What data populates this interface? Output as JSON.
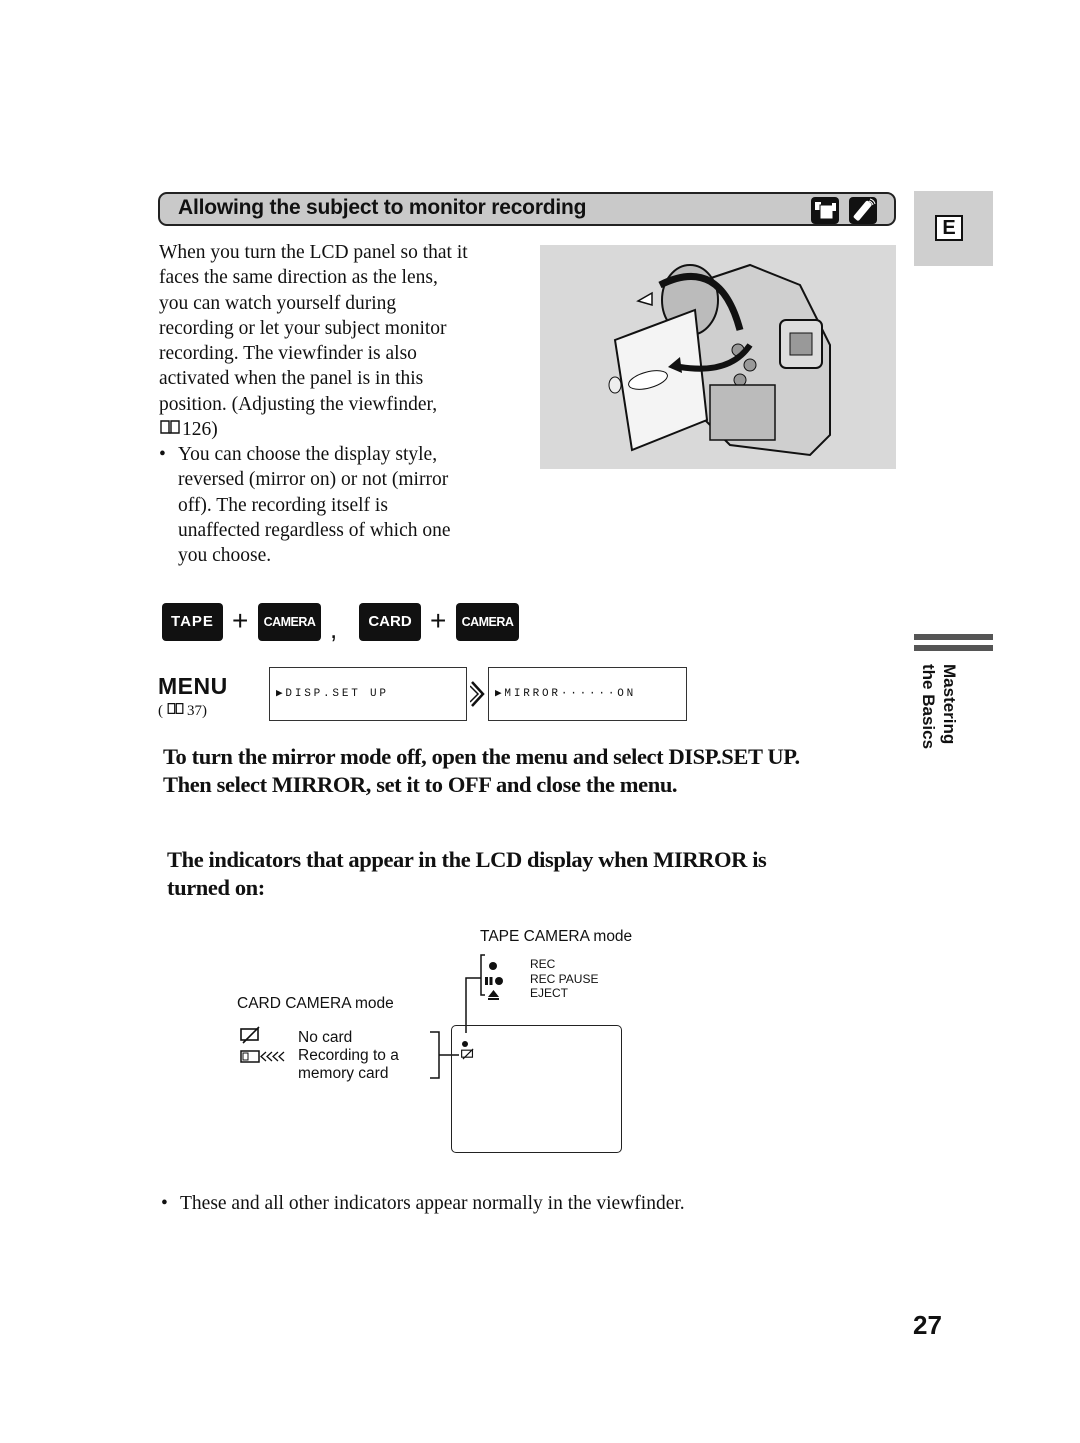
{
  "section": {
    "title": "Allowing the subject to monitor recording",
    "icons": [
      "camcorder-mode-icon",
      "remote-control-icon"
    ]
  },
  "language_tab": {
    "letter": "E"
  },
  "intro": {
    "lines": [
      "When you turn the LCD panel so that it",
      "faces the same direction as the lens,",
      "you can watch yourself during",
      "recording or let your subject monitor",
      "recording. The viewfinder is also",
      "activated when the panel is in this",
      "position. (Adjusting the viewfinder,"
    ],
    "ref_page": "126)"
  },
  "bullet": {
    "symbol": "•",
    "lines": [
      "You can choose the display style,",
      "reversed (mirror on) or not (mirror",
      "off). The recording itself is",
      "unaffected regardless of which one",
      "you choose."
    ]
  },
  "figure": {
    "description": "camcorder-lcd-panel-rotation-illustration"
  },
  "modes": {
    "key1": "TAPE",
    "plus1": "+",
    "key2": "CAMERA",
    "separator": ",",
    "key3": "CARD",
    "plus2": "+",
    "key4": "CAMERA"
  },
  "menu": {
    "label": "MENU",
    "ref": "37)",
    "ref_open": "(",
    "step1": "▶DISP.SET UP",
    "step2": "▶MIRROR······ON",
    "arrow": "»"
  },
  "side_tab": {
    "label": "Mastering\nthe Basics"
  },
  "instruction": {
    "line1": "To turn the mirror mode off, open the menu and select DISP.SET UP.",
    "line2": "Then select MIRROR, set it to OFF and close the menu."
  },
  "indicators_heading": {
    "line1": "The indicators that appear in the LCD display when MIRROR is",
    "line2": "turned on:"
  },
  "diagram": {
    "tape_mode_title": "TAPE CAMERA mode",
    "tape_items": [
      {
        "icon": "rec-dot-icon",
        "label": "REC"
      },
      {
        "icon": "rec-pause-icon",
        "label": "REC PAUSE"
      },
      {
        "icon": "eject-icon",
        "label": "EJECT"
      }
    ],
    "card_mode_title": "CARD CAMERA mode",
    "card_items": [
      {
        "icon": "no-card-icon",
        "label": "No card"
      },
      {
        "icon": "recording-to-card-icon",
        "label_line1": "Recording to a",
        "label_line2": "memory card"
      }
    ]
  },
  "footer_note": {
    "symbol": "•",
    "text": "These and all other indicators appear normally in the viewfinder."
  },
  "page_number": "27"
}
